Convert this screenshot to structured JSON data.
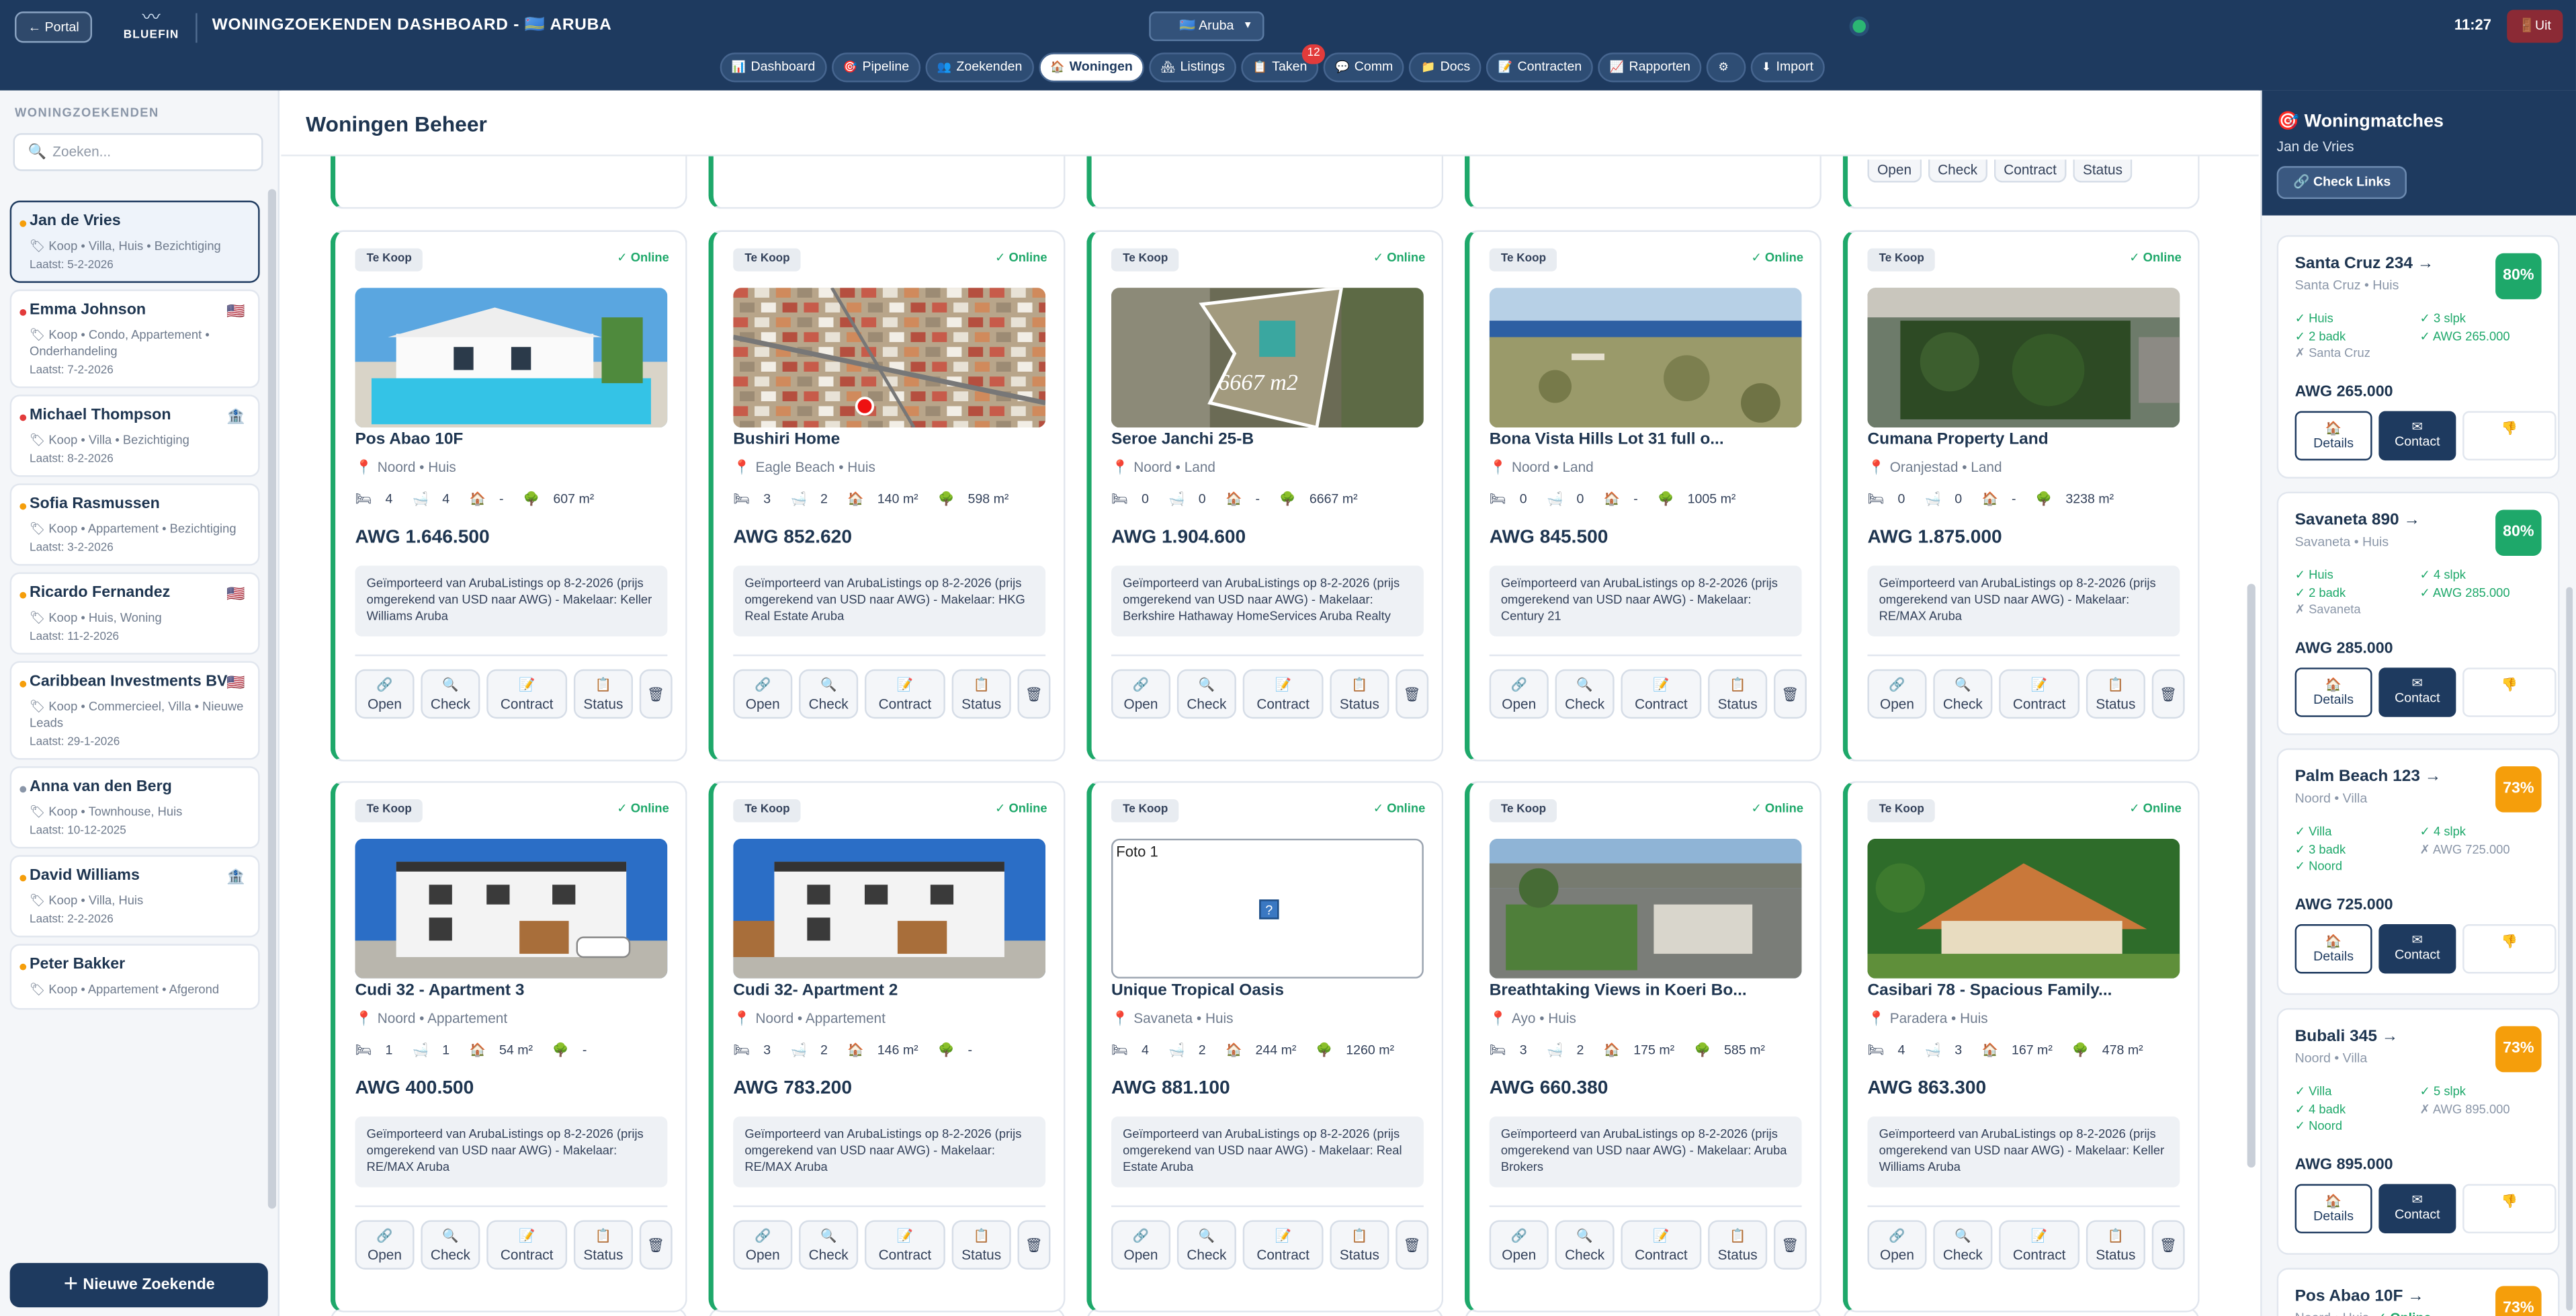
{
  "header": {
    "portal_label": "← Portal",
    "logo_text": "BLUEFIN",
    "title": "WONINGZOEKENDEN DASHBOARD - 🇦🇼 ARUBA",
    "region": "🇦🇼 Aruba",
    "time": "11:27",
    "logout_label": "Uit"
  },
  "nav": [
    {
      "icon": "📊",
      "label": "Dashboard"
    },
    {
      "icon": "🎯",
      "label": "Pipeline"
    },
    {
      "icon": "👥",
      "label": "Zoekenden"
    },
    {
      "icon": "🏠",
      "label": "Woningen",
      "active": true
    },
    {
      "icon": "🏘",
      "label": "Listings"
    },
    {
      "icon": "📋",
      "label": "Taken",
      "badge": "12"
    },
    {
      "icon": "💬",
      "label": "Comm"
    },
    {
      "icon": "📁",
      "label": "Docs"
    },
    {
      "icon": "📝",
      "label": "Contracten"
    },
    {
      "icon": "📈",
      "label": "Rapporten"
    },
    {
      "icon": "⚙",
      "label": ""
    },
    {
      "icon": "⬇",
      "label": "Import"
    }
  ],
  "sidebar": {
    "title": "WONINGZOEKENDEN",
    "search_placeholder": "Zoeken...",
    "new_button": "Nieuwe Zoekende",
    "seekers": [
      {
        "name": "Jan de Vries",
        "dot": "#f59e0b",
        "meta": "🏷 Koop • Villa, Huis • Bezichtiging",
        "last": "Laatst: 5-2-2026",
        "flag": "",
        "selected": true
      },
      {
        "name": "Emma Johnson",
        "dot": "#e23b3b",
        "meta": "🏷 Koop • Condo, Appartement • Onderhandeling",
        "last": "Laatst: 7-2-2026",
        "flag": "🇺🇸"
      },
      {
        "name": "Michael Thompson",
        "dot": "#e23b3b",
        "meta": "🏷 Koop • Villa • Bezichtiging",
        "last": "Laatst: 8-2-2026",
        "flag": "🏦"
      },
      {
        "name": "Sofia Rasmussen",
        "dot": "#f59e0b",
        "meta": "🏷 Koop • Appartement • Bezichtiging",
        "last": "Laatst: 3-2-2026",
        "flag": ""
      },
      {
        "name": "Ricardo Fernandez",
        "dot": "#f59e0b",
        "meta": "🏷 Koop • Huis, Woning",
        "last": "Laatst: 11-2-2026",
        "flag": "🇺🇸"
      },
      {
        "name": "Caribbean Investments BV",
        "dot": "#f59e0b",
        "meta": "🏷 Koop • Commercieel, Villa • Nieuwe Leads",
        "last": "Laatst: 29-1-2026",
        "flag": "🇺🇸"
      },
      {
        "name": "Anna van den Berg",
        "dot": "#8a96a8",
        "meta": "🏷 Koop • Townhouse, Huis",
        "last": "Laatst: 10-12-2025",
        "flag": ""
      },
      {
        "name": "David Williams",
        "dot": "#f59e0b",
        "meta": "🏷 Koop • Villa, Huis",
        "last": "Laatst: 2-2-2026",
        "flag": "🏦"
      },
      {
        "name": "Peter Bakker",
        "dot": "#f59e0b",
        "meta": "🏷 Koop • Appartement • Afgerond",
        "last": "",
        "flag": ""
      }
    ]
  },
  "main": {
    "title": "Woningen Beheer",
    "card_labels": {
      "tag": "Te Koop",
      "online": "✓ Online",
      "open": "Open",
      "check": "Check",
      "contract": "Contract",
      "status": "Status"
    },
    "properties": [
      {
        "title": "Pos Abao 10F",
        "loc": "Noord • Huis",
        "beds": "4",
        "baths": "4",
        "built": "-",
        "lot": "607 m²",
        "price": "AWG 1.646.500",
        "desc": "Geïmporteerd van ArubaListings op 8-2-2026 (prijs omgerekend van USD naar AWG) - Makelaar: Keller Williams Aruba",
        "photo": "pool"
      },
      {
        "title": "Bushiri Home",
        "loc": "Eagle Beach • Huis",
        "beds": "3",
        "baths": "2",
        "built": "140 m²",
        "lot": "598 m²",
        "price": "AWG 852.620",
        "desc": "Geïmporteerd van ArubaListings op 8-2-2026 (prijs omgerekend van USD naar AWG) - Makelaar: HKG Real Estate Aruba",
        "photo": "aerial"
      },
      {
        "title": "Seroe Janchi 25-B",
        "loc": "Noord • Land",
        "beds": "0",
        "baths": "0",
        "built": "-",
        "lot": "6667 m²",
        "price": "AWG 1.904.600",
        "desc": "Geïmporteerd van ArubaListings op 8-2-2026 (prijs omgerekend van USD naar AWG) - Makelaar: Berkshire Hathaway HomeServices Aruba Realty",
        "photo": "plot",
        "photo_text": "6667 m2"
      },
      {
        "title": "Bona Vista Hills Lot 31 full o...",
        "loc": "Noord • Land",
        "beds": "0",
        "baths": "0",
        "built": "-",
        "lot": "1005 m²",
        "price": "AWG 845.500",
        "desc": "Geïmporteerd van ArubaListings op 8-2-2026 (prijs omgerekend van USD naar AWG) - Makelaar: Century 21",
        "photo": "hills"
      },
      {
        "title": "Cumana Property Land",
        "loc": "Oranjestad • Land",
        "beds": "0",
        "baths": "0",
        "built": "-",
        "lot": "3238 m²",
        "price": "AWG 1.875.000",
        "desc": "Geïmporteerd van ArubaListings op 8-2-2026 (prijs omgerekend van USD naar AWG) - Makelaar: RE/MAX Aruba",
        "photo": "green"
      },
      {
        "title": "Cudi 32 - Apartment 3",
        "loc": "Noord • Appartement",
        "beds": "1",
        "baths": "1",
        "built": "54 m²",
        "lot": "-",
        "price": "AWG 400.500",
        "desc": "Geïmporteerd van ArubaListings op 8-2-2026 (prijs omgerekend van USD naar AWG) - Makelaar: RE/MAX Aruba",
        "photo": "white"
      },
      {
        "title": "Cudi 32- Apartment 2",
        "loc": "Noord • Appartement",
        "beds": "3",
        "baths": "2",
        "built": "146 m²",
        "lot": "-",
        "price": "AWG 783.200",
        "desc": "Geïmporteerd van ArubaListings op 8-2-2026 (prijs omgerekend van USD naar AWG) - Makelaar: RE/MAX Aruba",
        "photo": "white2"
      },
      {
        "title": "Unique Tropical Oasis",
        "loc": "Savaneta • Huis",
        "beds": "4",
        "baths": "2",
        "built": "244 m²",
        "lot": "1260 m²",
        "price": "AWG 881.100",
        "desc": "Geïmporteerd van ArubaListings op 8-2-2026 (prijs omgerekend van USD naar AWG) - Makelaar: Real Estate Aruba",
        "photo": "empty",
        "photo_text": "Foto 1"
      },
      {
        "title": "Breathtaking Views in Koeri Bo...",
        "loc": "Ayo • Huis",
        "beds": "3",
        "baths": "2",
        "built": "175 m²",
        "lot": "585 m²",
        "price": "AWG 660.380",
        "desc": "Geïmporteerd van ArubaListings op 8-2-2026 (prijs omgerekend van USD naar AWG) - Makelaar: Aruba Brokers",
        "photo": "garden"
      },
      {
        "title": "Casibari 78 - Spacious Family...",
        "loc": "Paradera • Huis",
        "beds": "4",
        "baths": "3",
        "built": "167 m²",
        "lot": "478 m²",
        "price": "AWG 863.300",
        "desc": "Geïmporteerd van ArubaListings op 8-2-2026 (prijs omgerekend van USD naar AWG) - Makelaar: Keller Williams Aruba",
        "photo": "roof"
      }
    ]
  },
  "matches": {
    "title": "🎯 Woningmatches",
    "subtitle": "Jan de Vries",
    "check_links": "🔗 Check Links",
    "labels": {
      "details": "Details",
      "contact": "Contact"
    },
    "items": [
      {
        "name": "Santa Cruz 234 →",
        "loc": "Santa Cruz • Huis",
        "score": "80%",
        "color": "#1ea86a",
        "features": [
          [
            "✓ Huis",
            "✓ 3 slpk"
          ],
          [
            "✓ 2 badk",
            "✓ AWG 265.000"
          ],
          [
            "✗ Santa Cruz",
            ""
          ]
        ],
        "price": "AWG 265.000"
      },
      {
        "name": "Savaneta 890 →",
        "loc": "Savaneta • Huis",
        "score": "80%",
        "color": "#1ea86a",
        "features": [
          [
            "✓ Huis",
            "✓ 4 slpk"
          ],
          [
            "✓ 2 badk",
            "✓ AWG 285.000"
          ],
          [
            "✗ Savaneta",
            ""
          ]
        ],
        "price": "AWG 285.000"
      },
      {
        "name": "Palm Beach 123 →",
        "loc": "Noord • Villa",
        "score": "73%",
        "color": "#f59e0b",
        "features": [
          [
            "✓ Villa",
            "✓ 4 slpk"
          ],
          [
            "✓ 3 badk",
            "✗ AWG 725.000"
          ],
          [
            "✓ Noord",
            ""
          ]
        ],
        "price": "AWG 725.000"
      },
      {
        "name": "Bubali 345 →",
        "loc": "Noord • Villa",
        "score": "73%",
        "color": "#f59e0b",
        "features": [
          [
            "✓ Villa",
            "✓ 5 slpk"
          ],
          [
            "✓ 4 badk",
            "✗ AWG 895.000"
          ],
          [
            "✓ Noord",
            ""
          ]
        ],
        "price": "AWG 895.000"
      },
      {
        "name": "Pos Abao 10F →",
        "loc": "Noord • Huis",
        "score": "73%",
        "color": "#f59e0b",
        "online": "✓ Online",
        "features": [],
        "price": ""
      }
    ]
  }
}
